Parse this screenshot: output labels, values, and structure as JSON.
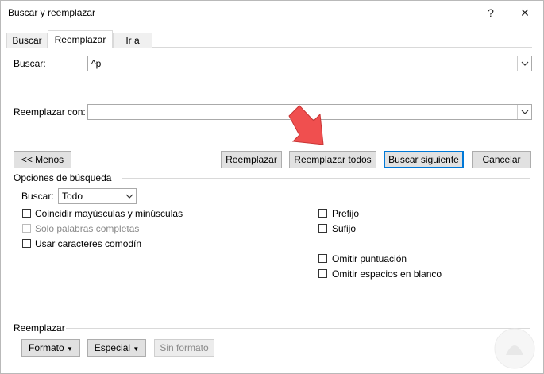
{
  "window": {
    "title": "Buscar y reemplazar",
    "help": "?",
    "close": "✕"
  },
  "tabs": [
    {
      "label": "Buscar"
    },
    {
      "label": "Reemplazar"
    },
    {
      "label": "Ir a"
    }
  ],
  "find": {
    "label": "Buscar:",
    "value": "^p"
  },
  "replace": {
    "label": "Reemplazar con:",
    "value": ""
  },
  "buttons": {
    "less": "<< Menos",
    "replace": "Reemplazar",
    "replace_all": "Reemplazar todos",
    "find_next": "Buscar siguiente",
    "cancel": "Cancelar"
  },
  "options": {
    "section_title": "Opciones de búsqueda",
    "search_label": "Buscar:",
    "search_value": "Todo",
    "match_case": {
      "label": "Coincidir mayúsculas y minúsculas",
      "checked": false
    },
    "whole_words": {
      "label": "Solo palabras completas",
      "checked": false,
      "disabled": true
    },
    "wildcards": {
      "label": "Usar caracteres comodín",
      "checked": false
    },
    "prefix": {
      "label": "Prefijo",
      "checked": false
    },
    "suffix": {
      "label": "Sufijo",
      "checked": false
    },
    "ignore_punct": {
      "label": "Omitir puntuación",
      "checked": false
    },
    "ignore_space": {
      "label": "Omitir espacios en blanco",
      "checked": false
    }
  },
  "replace_section": {
    "title": "Reemplazar",
    "format": "Formato",
    "special": "Especial",
    "no_format": "Sin formato"
  },
  "colors": {
    "accent": "#0078d7",
    "arrow": "#f04f4f"
  }
}
